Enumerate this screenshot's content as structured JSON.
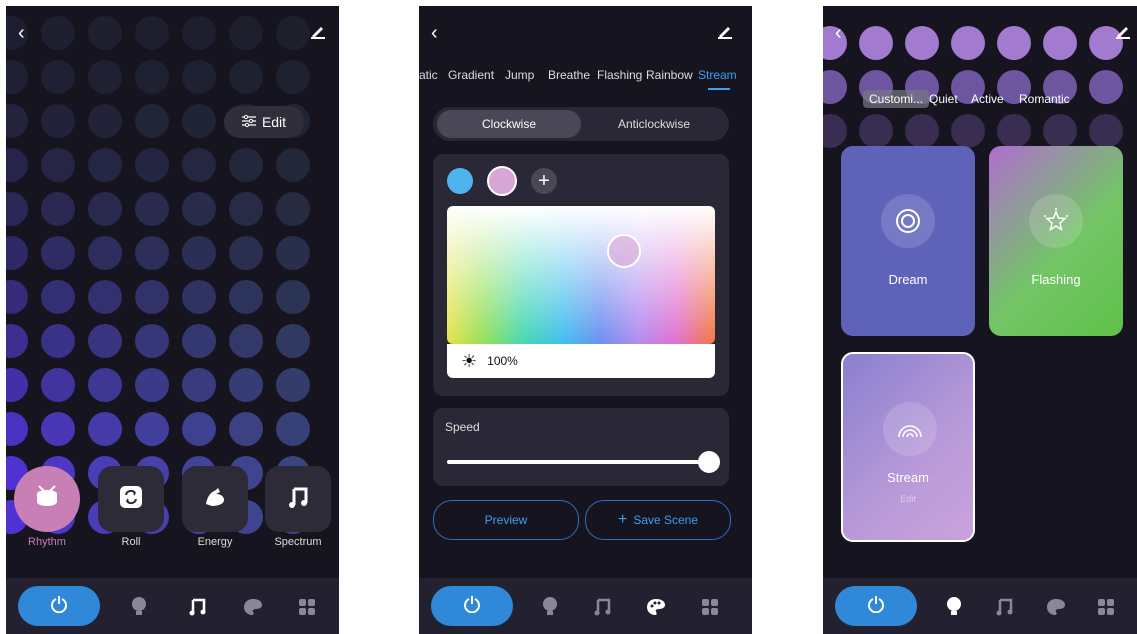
{
  "colors": {
    "accent": "#3aa0f0",
    "bg": "#16141f",
    "power": "#2f88d8",
    "rhythm_active": "#c77fb6",
    "swatch_blue": "#4fb4ee",
    "swatch_pink": "#d8a6d6"
  },
  "screen1": {
    "edit_label": "Edit",
    "modes": [
      {
        "label": "Rhythm",
        "icon": "drum-icon",
        "active": true
      },
      {
        "label": "Roll",
        "icon": "repeat-icon",
        "active": false
      },
      {
        "label": "Energy",
        "icon": "muscle-icon",
        "active": false
      },
      {
        "label": "Spectrum",
        "icon": "music-note-icon",
        "active": false
      }
    ]
  },
  "screen2": {
    "tabs": [
      "atic",
      "Gradient",
      "Jump",
      "Breathe",
      "Flashing",
      "Rainbow",
      "Stream"
    ],
    "active_tab": "Stream",
    "direction": {
      "options": [
        "Clockwise",
        "Anticlockwise"
      ],
      "selected": "Clockwise"
    },
    "brightness": "100%",
    "speed_label": "Speed",
    "speed_value": 1.0,
    "preview_label": "Preview",
    "save_label": "Save Scene"
  },
  "screen3": {
    "tabs": [
      "Customi...",
      "Quiet",
      "Active",
      "Romantic"
    ],
    "scenes": [
      {
        "label": "Dream",
        "icon": "concentric-circle-icon"
      },
      {
        "label": "Flashing",
        "icon": "sparkle-star-icon"
      },
      {
        "label": "Stream",
        "icon": "rainbow-icon",
        "sub": "Edit"
      }
    ]
  }
}
